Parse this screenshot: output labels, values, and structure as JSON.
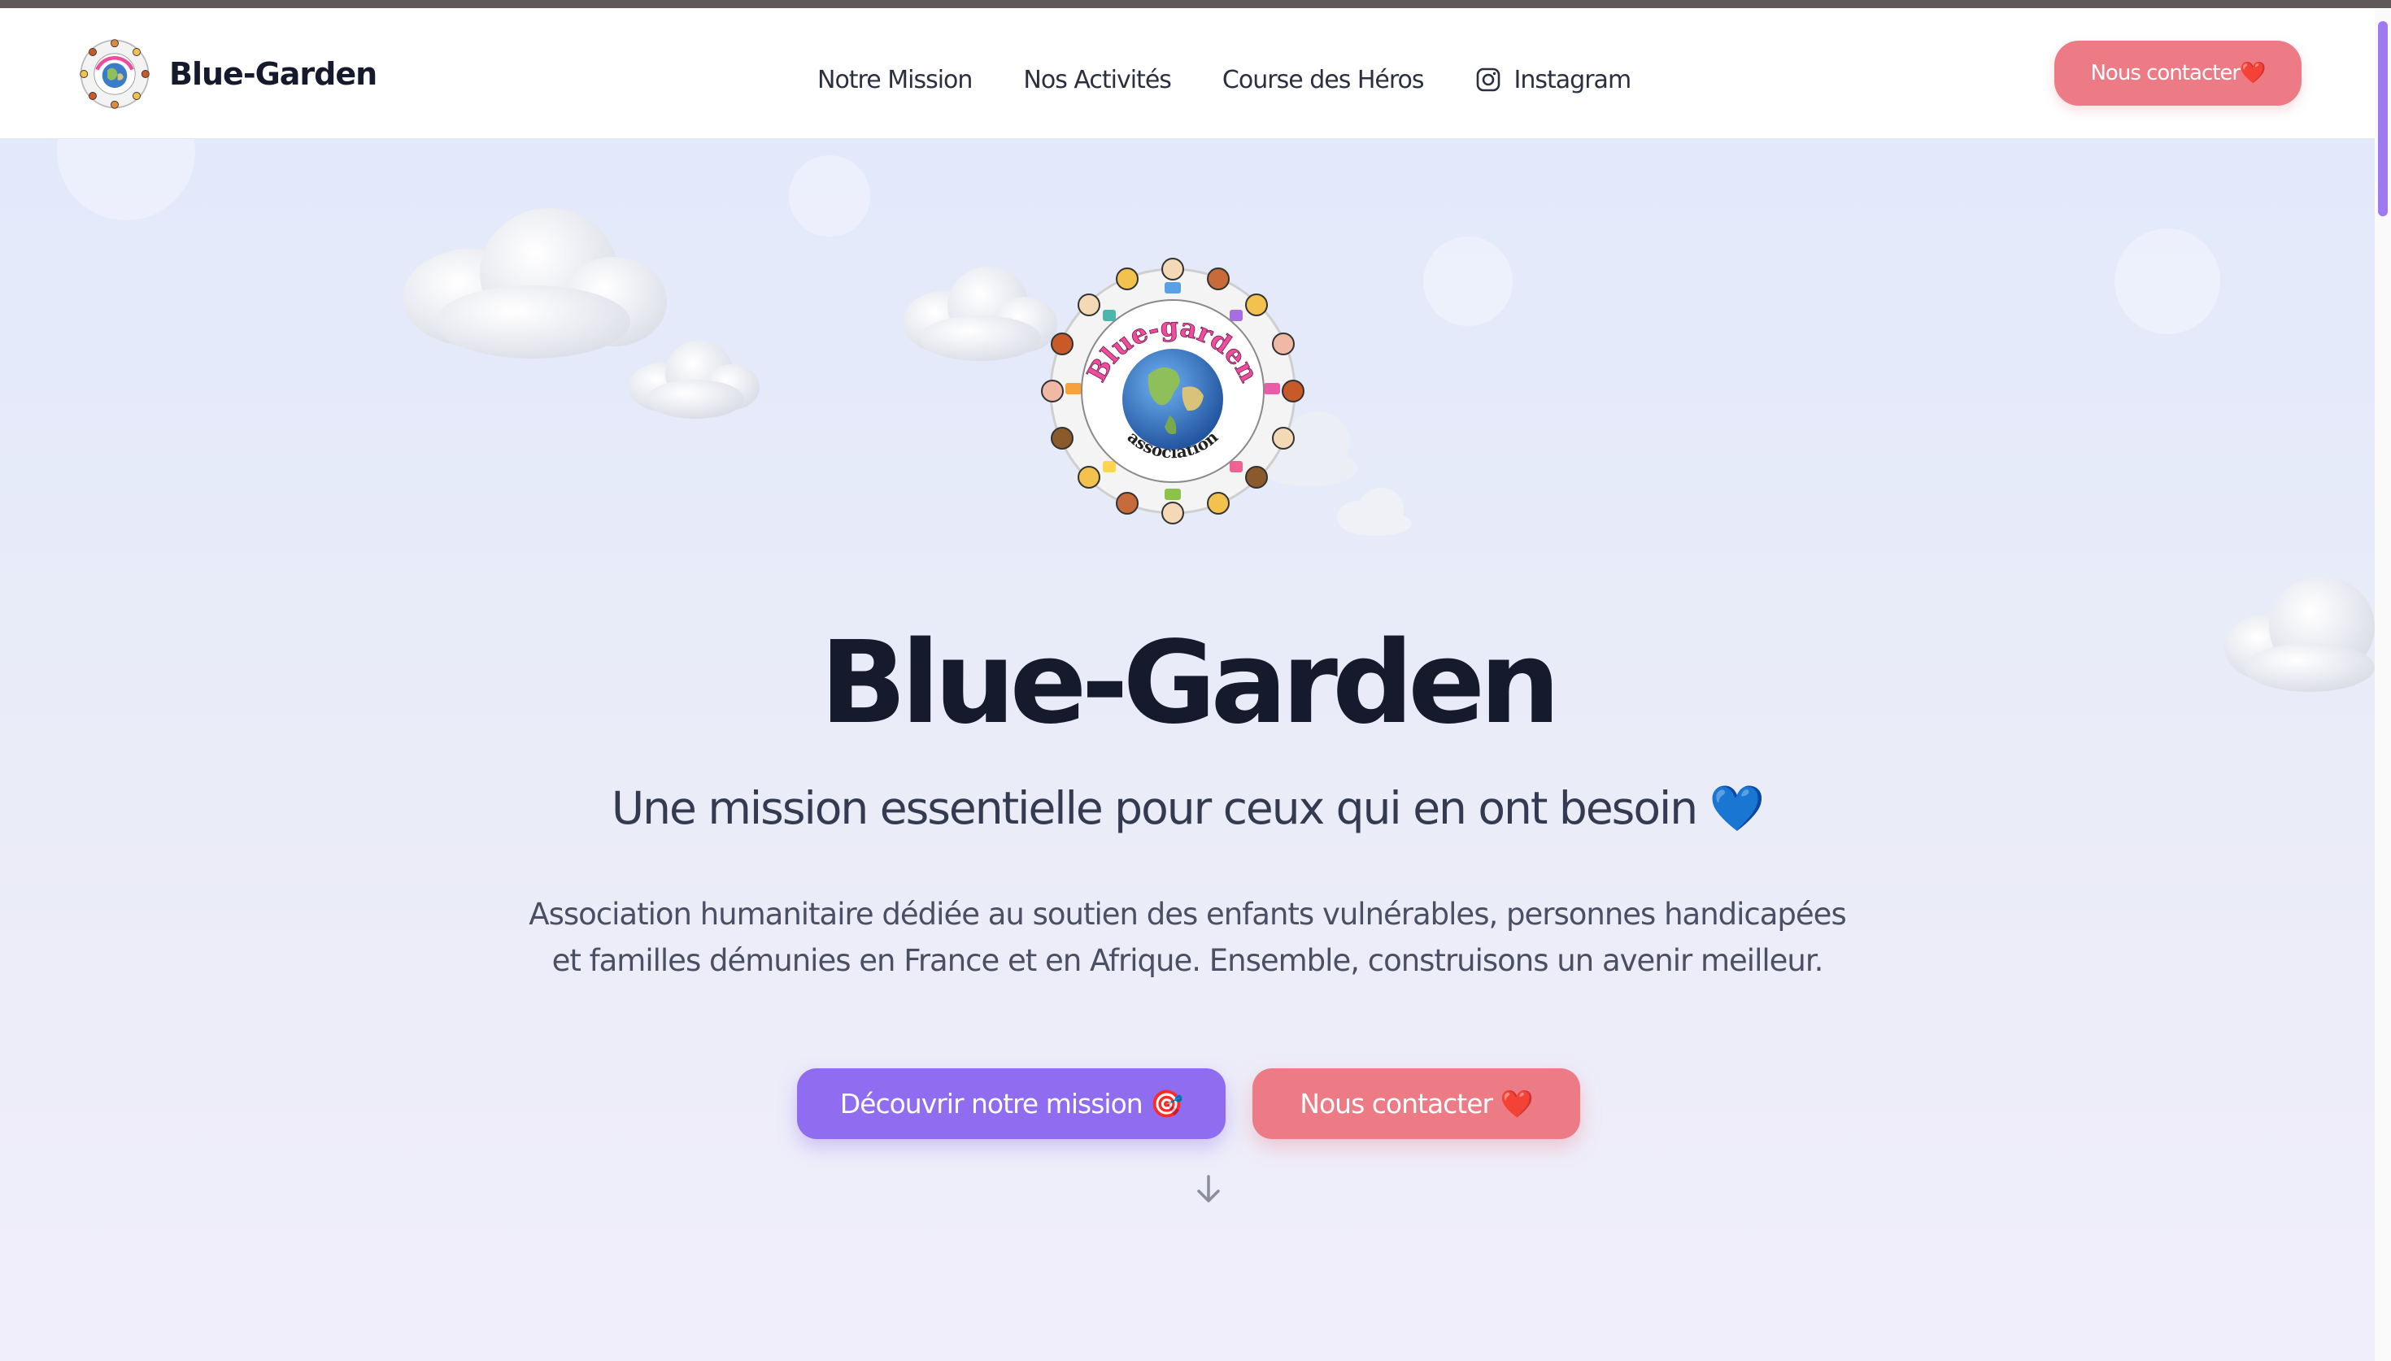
{
  "header": {
    "brand_name": "Blue-Garden",
    "nav": [
      {
        "label": "Notre Mission"
      },
      {
        "label": "Nos Activités"
      },
      {
        "label": "Course des Héros"
      },
      {
        "label": "Instagram",
        "icon": "instagram-icon"
      }
    ],
    "cta_label": "Nous contacter❤️"
  },
  "hero": {
    "logo_text_top": "Blue-garden",
    "logo_text_bottom": "association",
    "title": "Blue-Garden",
    "subtitle": "Une mission essentielle pour ceux qui en ont besoin 💙",
    "description_line1": "Association humanitaire dédiée au soutien des enfants vulnérables, personnes handicapées",
    "description_line2": "et familles démunies en France et en Afrique. Ensemble, construisons un avenir meilleur.",
    "primary_button": "Découvrir notre mission 🎯",
    "secondary_button": "Nous contacter ❤️",
    "scroll_icon": "arrow-down-icon"
  },
  "colors": {
    "accent_purple": "#8f6cf0",
    "accent_pink": "#ec7b85",
    "text_dark": "#151a2d"
  }
}
